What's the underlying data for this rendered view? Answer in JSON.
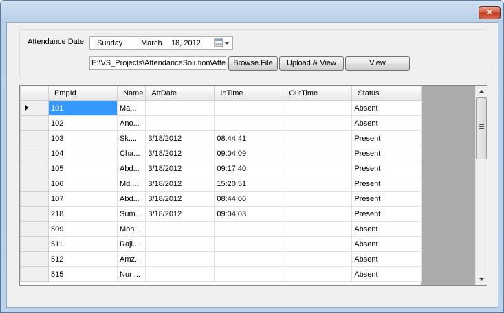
{
  "window": {
    "close_glyph": "✕"
  },
  "form": {
    "date_label": "Attendance Date:",
    "date_picker": {
      "weekday": "Sunday",
      "sep": ",",
      "month": "March",
      "day_year": "18, 2012"
    },
    "file_path": "E:\\VS_Projects\\AttendanceSolution\\Atte",
    "browse_label": "Browse File",
    "upload_label": "Upload & View",
    "view_label": "View"
  },
  "grid": {
    "columns": [
      "EmpId",
      "Name",
      "AttDate",
      "InTime",
      "OutTime",
      "Status"
    ],
    "rows": [
      [
        "101",
        "Ma...",
        "",
        "",
        "",
        "Absent"
      ],
      [
        "102",
        "Ano...",
        "",
        "",
        "",
        "Absent"
      ],
      [
        "103",
        "Sk....",
        "3/18/2012",
        "08:44:41",
        "",
        "Present"
      ],
      [
        "104",
        "Cha...",
        "3/18/2012",
        "09:04:09",
        "",
        "Present"
      ],
      [
        "105",
        "Abd...",
        "3/18/2012",
        "09:17:40",
        "",
        "Present"
      ],
      [
        "106",
        "Md....",
        "3/18/2012",
        "15:20:51",
        "",
        "Present"
      ],
      [
        "107",
        "Abd...",
        "3/18/2012",
        "08:44:06",
        "",
        "Present"
      ],
      [
        "218",
        "Sum...",
        "3/18/2012",
        "09:04:03",
        "",
        "Present"
      ],
      [
        "509",
        "Moh...",
        "",
        "",
        "",
        "Absent"
      ],
      [
        "511",
        "Raji...",
        "",
        "",
        "",
        "Absent"
      ],
      [
        "512",
        "Amz...",
        "",
        "",
        "",
        "Absent"
      ],
      [
        "515",
        "Nur ...",
        "",
        "",
        "",
        "Absent"
      ]
    ],
    "selected_row": 0
  },
  "colors": {
    "selection": "#3399ff",
    "grid_background": "#ababab"
  },
  "icons": [
    "close-icon",
    "calendar-icon",
    "dropdown-arrow-icon",
    "row-indicator-icon",
    "scroll-up-icon",
    "scroll-down-icon"
  ]
}
